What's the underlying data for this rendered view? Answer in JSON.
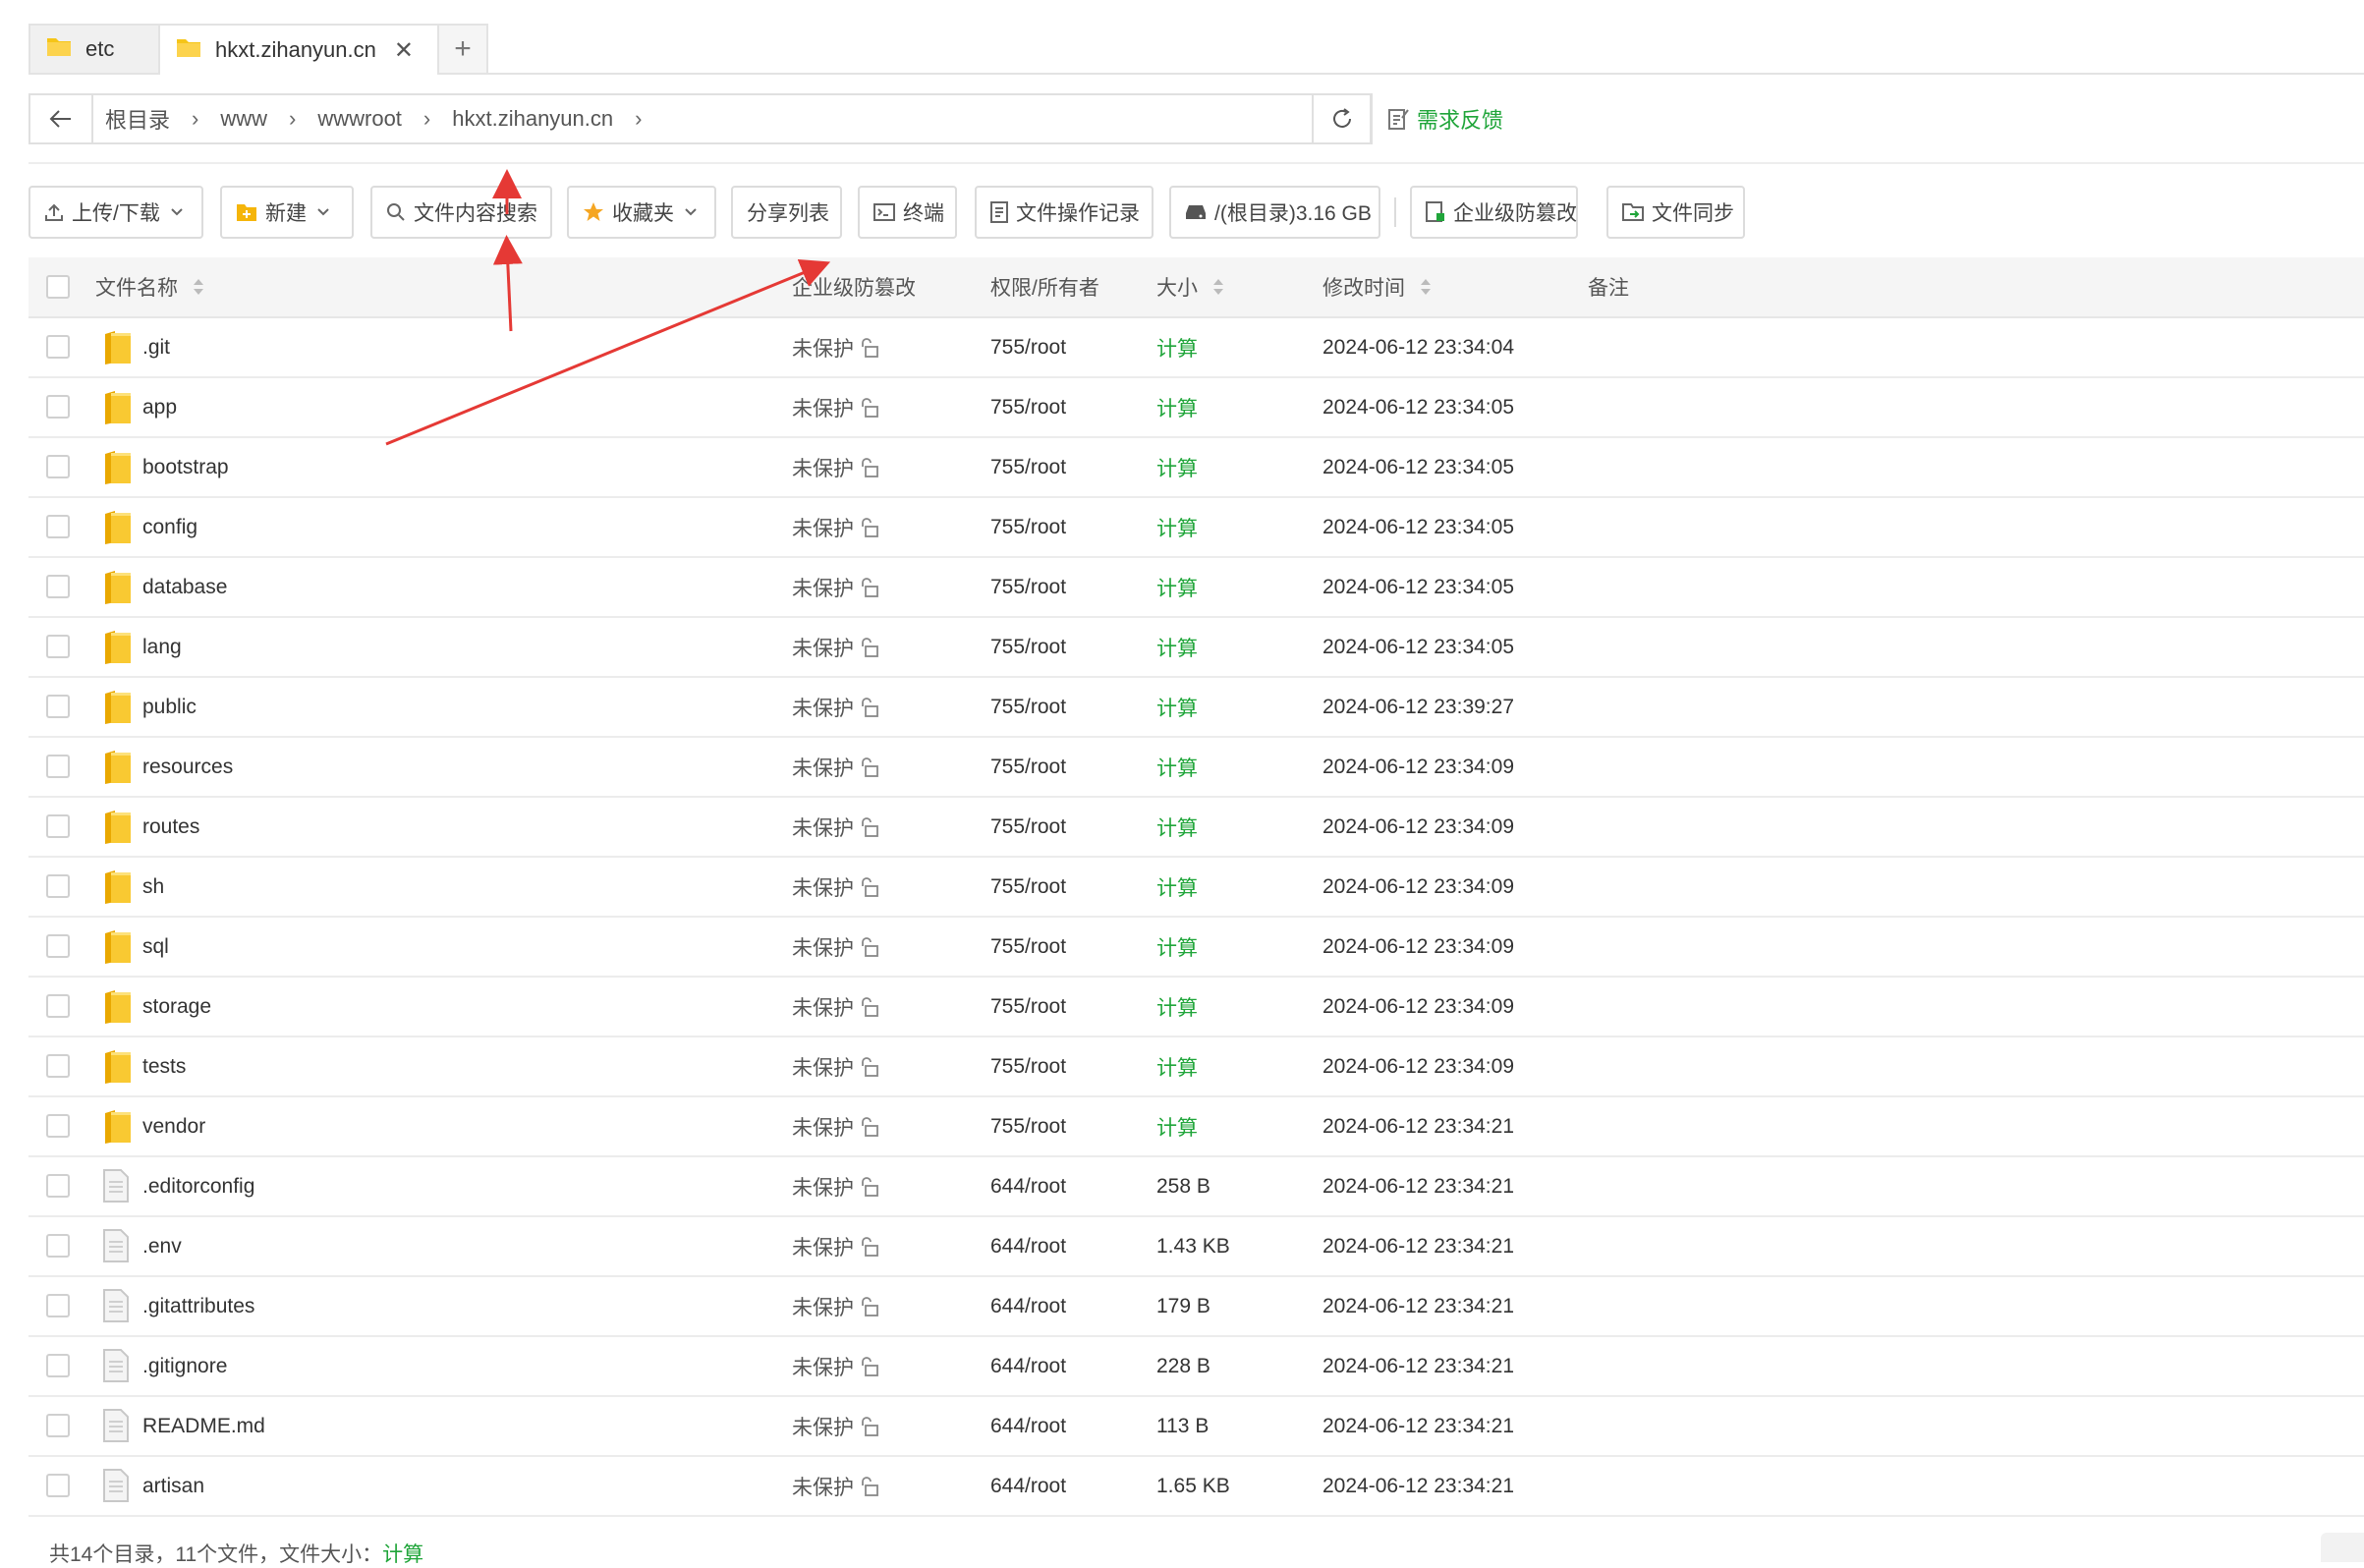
{
  "tabs": [
    {
      "label": "etc"
    },
    {
      "label": "hkxt.zihanyun.cn"
    }
  ],
  "breadcrumb": [
    "根目录",
    "www",
    "wwwroot",
    "hkxt.zihanyun.cn"
  ],
  "feedback_label": "需求反馈",
  "toolbar": {
    "upload": "上传/下载",
    "new": "新建",
    "search": "文件内容搜索",
    "favorites": "收藏夹",
    "share_list": "分享列表",
    "terminal": "终端",
    "op_log": "文件操作记录",
    "disk": "/(根目录)3.16 GB",
    "tamper": "企业级防篡改",
    "sync": "文件同步"
  },
  "columns": {
    "name": "文件名称",
    "tamper": "企业级防篡改",
    "perm": "权限/所有者",
    "size": "大小",
    "mtime": "修改时间",
    "note": "备注"
  },
  "rows": [
    {
      "name": ".git",
      "type": "folder",
      "protect": "未保护",
      "perm": "755/root",
      "size": "计算",
      "mtime": "2024-06-12 23:34:04"
    },
    {
      "name": "app",
      "type": "folder",
      "protect": "未保护",
      "perm": "755/root",
      "size": "计算",
      "mtime": "2024-06-12 23:34:05"
    },
    {
      "name": "bootstrap",
      "type": "folder",
      "protect": "未保护",
      "perm": "755/root",
      "size": "计算",
      "mtime": "2024-06-12 23:34:05"
    },
    {
      "name": "config",
      "type": "folder",
      "protect": "未保护",
      "perm": "755/root",
      "size": "计算",
      "mtime": "2024-06-12 23:34:05"
    },
    {
      "name": "database",
      "type": "folder",
      "protect": "未保护",
      "perm": "755/root",
      "size": "计算",
      "mtime": "2024-06-12 23:34:05"
    },
    {
      "name": "lang",
      "type": "folder",
      "protect": "未保护",
      "perm": "755/root",
      "size": "计算",
      "mtime": "2024-06-12 23:34:05"
    },
    {
      "name": "public",
      "type": "folder",
      "protect": "未保护",
      "perm": "755/root",
      "size": "计算",
      "mtime": "2024-06-12 23:39:27"
    },
    {
      "name": "resources",
      "type": "folder",
      "protect": "未保护",
      "perm": "755/root",
      "size": "计算",
      "mtime": "2024-06-12 23:34:09"
    },
    {
      "name": "routes",
      "type": "folder",
      "protect": "未保护",
      "perm": "755/root",
      "size": "计算",
      "mtime": "2024-06-12 23:34:09"
    },
    {
      "name": "sh",
      "type": "folder",
      "protect": "未保护",
      "perm": "755/root",
      "size": "计算",
      "mtime": "2024-06-12 23:34:09"
    },
    {
      "name": "sql",
      "type": "folder",
      "protect": "未保护",
      "perm": "755/root",
      "size": "计算",
      "mtime": "2024-06-12 23:34:09"
    },
    {
      "name": "storage",
      "type": "folder",
      "protect": "未保护",
      "perm": "755/root",
      "size": "计算",
      "mtime": "2024-06-12 23:34:09"
    },
    {
      "name": "tests",
      "type": "folder",
      "protect": "未保护",
      "perm": "755/root",
      "size": "计算",
      "mtime": "2024-06-12 23:34:09"
    },
    {
      "name": "vendor",
      "type": "folder",
      "protect": "未保护",
      "perm": "755/root",
      "size": "计算",
      "mtime": "2024-06-12 23:34:21"
    },
    {
      "name": ".editorconfig",
      "type": "file",
      "protect": "未保护",
      "perm": "644/root",
      "size": "258 B",
      "mtime": "2024-06-12 23:34:21"
    },
    {
      "name": ".env",
      "type": "file",
      "protect": "未保护",
      "perm": "644/root",
      "size": "1.43 KB",
      "mtime": "2024-06-12 23:34:21"
    },
    {
      "name": ".gitattributes",
      "type": "file",
      "protect": "未保护",
      "perm": "644/root",
      "size": "179 B",
      "mtime": "2024-06-12 23:34:21"
    },
    {
      "name": ".gitignore",
      "type": "file",
      "protect": "未保护",
      "perm": "644/root",
      "size": "228 B",
      "mtime": "2024-06-12 23:34:21"
    },
    {
      "name": "README.md",
      "type": "file",
      "protect": "未保护",
      "perm": "644/root",
      "size": "113 B",
      "mtime": "2024-06-12 23:34:21"
    },
    {
      "name": "artisan",
      "type": "file",
      "protect": "未保护",
      "perm": "644/root",
      "size": "1.65 KB",
      "mtime": "2024-06-12 23:34:21"
    }
  ],
  "footer": {
    "summary": "共14个目录，11个文件，文件大小：",
    "calc": "计算"
  },
  "colors": {
    "accent_green": "#20a53a",
    "folder_yellow": "#f5c518",
    "annotation_red": "#e53935"
  }
}
